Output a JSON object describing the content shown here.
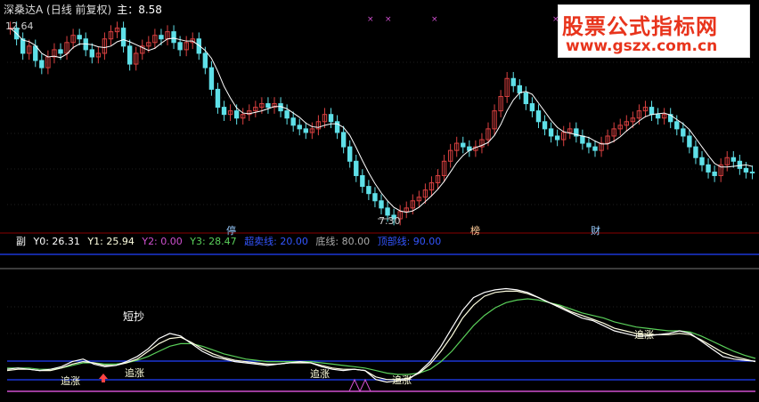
{
  "price_panel": {
    "title": "深桑达A (日线 前复权)",
    "main_label": "主：8.58",
    "max_price_label": "12.64",
    "min_price_label": "7.30",
    "events": [
      "停",
      "榜",
      "财"
    ]
  },
  "indicator_panel": {
    "name": "副",
    "y0": "Y0: 26.31",
    "y1": "Y1: 25.94",
    "y2": "Y2: 0.00",
    "y3": "Y3: 28.47",
    "oversold": "超卖线: 20.00",
    "bottom": "底线: 80.00",
    "top": "顶部线: 90.00",
    "signal_short": "短抄",
    "signal_chase": "追涨"
  },
  "watermark": {
    "title": "股票公式指标网",
    "url": "www.gszx.com.cn"
  },
  "colors": {
    "up": "#d94040",
    "down": "#5fe0e8",
    "ma": "#ffffff",
    "y0": "#ffffff",
    "y1": "#ffffe0",
    "y2": "#d050d0",
    "y3": "#5ad05a",
    "band": "#2040ff",
    "brand_red": "#e8341c"
  },
  "chart_data": {
    "type": "line",
    "price_range": [
      7.3,
      12.64
    ],
    "closes": [
      12.6,
      12.3,
      11.9,
      12.1,
      11.7,
      11.5,
      11.8,
      12.0,
      11.9,
      12.2,
      12.4,
      12.3,
      12.0,
      11.8,
      11.9,
      12.3,
      12.5,
      12.6,
      12.1,
      11.6,
      11.9,
      12.1,
      12.2,
      12.4,
      12.3,
      12.5,
      12.2,
      12.0,
      12.2,
      12.3,
      11.9,
      11.5,
      10.9,
      10.4,
      10.2,
      10.3,
      10.1,
      10.2,
      10.3,
      10.4,
      10.5,
      10.4,
      10.5,
      10.3,
      10.1,
      9.9,
      9.8,
      9.7,
      9.8,
      10.0,
      10.2,
      10.0,
      9.7,
      9.3,
      8.9,
      8.5,
      8.2,
      8.0,
      7.8,
      7.6,
      7.4,
      7.3,
      7.5,
      7.6,
      7.8,
      7.9,
      8.1,
      8.3,
      8.5,
      8.9,
      9.2,
      9.4,
      9.3,
      9.2,
      9.3,
      9.5,
      9.8,
      10.3,
      10.7,
      11.2,
      11.0,
      10.8,
      10.5,
      10.3,
      10.0,
      9.8,
      9.6,
      9.5,
      9.7,
      9.8,
      9.6,
      9.4,
      9.3,
      9.2,
      9.4,
      9.6,
      9.8,
      9.9,
      10.0,
      10.1,
      10.3,
      10.4,
      10.2,
      10.1,
      10.2,
      10.0,
      9.8,
      9.6,
      9.3,
      9.0,
      8.8,
      8.6,
      8.5,
      8.8,
      9.0,
      8.9,
      8.7,
      8.6,
      8.58
    ],
    "indicator_range": [
      0,
      100
    ],
    "y0": [
      20,
      21,
      20,
      19,
      20,
      22,
      26,
      28,
      24,
      22,
      23,
      26,
      30,
      36,
      44,
      48,
      46,
      40,
      34,
      30,
      28,
      26,
      25,
      24,
      23,
      24,
      25,
      26,
      25,
      22,
      20,
      19,
      20,
      19,
      12,
      10,
      11,
      12,
      18,
      26,
      38,
      52,
      66,
      76,
      80,
      82,
      83,
      82,
      80,
      76,
      72,
      68,
      64,
      60,
      58,
      54,
      50,
      48,
      46,
      46,
      47,
      48,
      50,
      48,
      42,
      36,
      30,
      28,
      27,
      26.3
    ],
    "y1": [
      19,
      20,
      20,
      19,
      19,
      21,
      24,
      26,
      25,
      23,
      23,
      25,
      28,
      34,
      40,
      44,
      45,
      41,
      36,
      32,
      29,
      27,
      26,
      25,
      24,
      24,
      25,
      25,
      25,
      23,
      21,
      20,
      20,
      19,
      14,
      12,
      12,
      13,
      17,
      24,
      34,
      46,
      60,
      70,
      77,
      80,
      81,
      81,
      79,
      76,
      72,
      69,
      65,
      62,
      59,
      56,
      52,
      50,
      48,
      47,
      47,
      47,
      48,
      47,
      43,
      38,
      33,
      30,
      28,
      25.9
    ],
    "y3": [
      21,
      21,
      21,
      20,
      20,
      21,
      23,
      25,
      25,
      24,
      24,
      25,
      27,
      30,
      34,
      38,
      40,
      40,
      38,
      35,
      32,
      30,
      28,
      27,
      26,
      26,
      26,
      26,
      26,
      25,
      24,
      23,
      22,
      21,
      19,
      17,
      16,
      16,
      17,
      20,
      26,
      34,
      44,
      54,
      62,
      68,
      72,
      74,
      75,
      74,
      72,
      70,
      67,
      64,
      62,
      60,
      57,
      55,
      53,
      52,
      51,
      50,
      50,
      49,
      46,
      42,
      38,
      34,
      31,
      28.5
    ],
    "bands": [
      20,
      80,
      90
    ]
  }
}
